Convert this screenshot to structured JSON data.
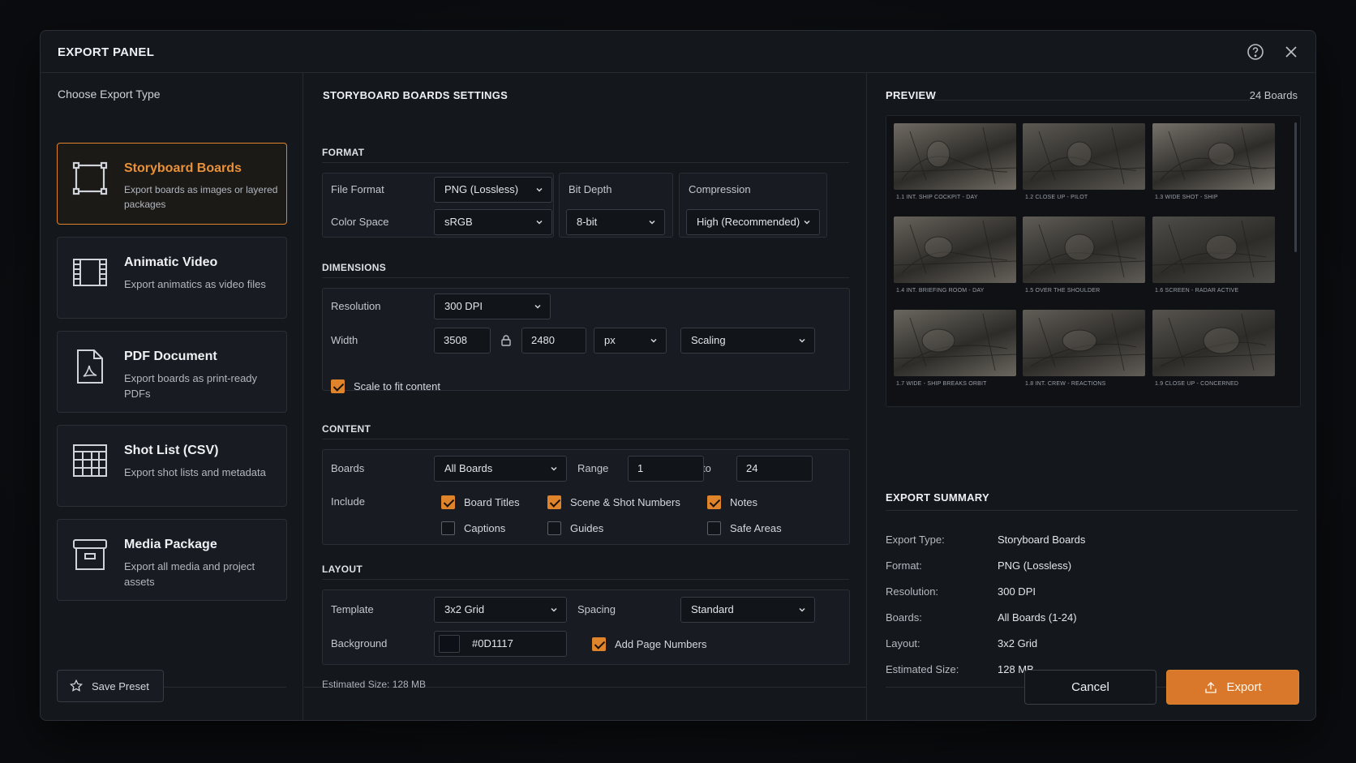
{
  "dialog": {
    "title": "EXPORT PANEL"
  },
  "left": {
    "heading": "Choose Export Type",
    "types": [
      {
        "title": "Storyboard Boards",
        "desc": "Export boards as images or layered packages",
        "icon": "storyboard-frame-icon",
        "active": true
      },
      {
        "title": "Animatic Video",
        "desc": "Export animatics as video files",
        "icon": "film-strip-icon",
        "active": false
      },
      {
        "title": "PDF Document",
        "desc": "Export boards as print-ready PDFs",
        "icon": "pdf-file-icon",
        "active": false
      },
      {
        "title": "Shot List (CSV)",
        "desc": "Export shot lists and metadata",
        "icon": "table-grid-icon",
        "active": false
      },
      {
        "title": "Media Package",
        "desc": "Export all media and project assets",
        "icon": "archive-box-icon",
        "active": false
      }
    ],
    "save_preset": "Save Preset"
  },
  "settings": {
    "heading": "STORYBOARD BOARDS SETTINGS",
    "format": {
      "label": "FORMAT",
      "file_format_label": "File Format",
      "file_format": "PNG (Lossless)",
      "color_space_label": "Color Space",
      "color_space": "sRGB",
      "bit_depth_label": "Bit Depth",
      "bit_depth": "8-bit",
      "compression_label": "Compression",
      "compression": "High (Recommended)"
    },
    "dimensions": {
      "label": "DIMENSIONS",
      "resolution_label": "Resolution",
      "resolution": "300 DPI",
      "width_label": "Width",
      "width": "3508",
      "height": "2480",
      "unit": "px",
      "scaling": "Scaling",
      "scale_to_fit_label": "Scale to fit content",
      "scale_to_fit": true
    },
    "content": {
      "label": "CONTENT",
      "boards_label": "Boards",
      "boards": "All Boards",
      "range_label": "Range",
      "range_from": "1",
      "range_to_label": "to",
      "range_to": "24",
      "include_label": "Include",
      "options": {
        "board_titles": {
          "label": "Board Titles",
          "checked": true
        },
        "scene_shot_numbers": {
          "label": "Scene & Shot Numbers",
          "checked": true
        },
        "notes": {
          "label": "Notes",
          "checked": true
        },
        "captions": {
          "label": "Captions",
          "checked": false
        },
        "guides": {
          "label": "Guides",
          "checked": false
        },
        "safe_areas": {
          "label": "Safe Areas",
          "checked": false
        }
      }
    },
    "layout": {
      "label": "LAYOUT",
      "template_label": "Template",
      "template": "3x2 Grid",
      "spacing_label": "Spacing",
      "spacing": "Standard",
      "background_label": "Background",
      "background": "#0D1117",
      "add_page_numbers_label": "Add Page Numbers",
      "add_page_numbers": true
    },
    "estimated_size": "Estimated Size: 128 MB"
  },
  "preview": {
    "heading": "PREVIEW",
    "count": "24 Boards",
    "boards": [
      {
        "caption": "1.1   INT. SHIP COCKPIT - DAY"
      },
      {
        "caption": "1.2   CLOSE UP - PILOT"
      },
      {
        "caption": "1.3   WIDE SHOT - SHIP"
      },
      {
        "caption": "1.4   INT. BRIEFING ROOM - DAY"
      },
      {
        "caption": "1.5   OVER THE SHOULDER"
      },
      {
        "caption": "1.6   SCREEN - RADAR ACTIVE"
      },
      {
        "caption": "1.7   WIDE - SHIP BREAKS ORBIT"
      },
      {
        "caption": "1.8   INT. CREW - REACTIONS"
      },
      {
        "caption": "1.9   CLOSE UP - CONCERNED"
      }
    ]
  },
  "summary": {
    "heading": "EXPORT SUMMARY",
    "rows": [
      {
        "key": "Export Type:",
        "value": "Storyboard Boards"
      },
      {
        "key": "Format:",
        "value": "PNG (Lossless)"
      },
      {
        "key": "Resolution:",
        "value": "300 DPI"
      },
      {
        "key": "Boards:",
        "value": "All Boards (1-24)"
      },
      {
        "key": "Layout:",
        "value": "3x2 Grid"
      },
      {
        "key": "Estimated Size:",
        "value": "128 MB"
      }
    ]
  },
  "actions": {
    "cancel": "Cancel",
    "export": "Export"
  },
  "colors": {
    "accent": "#E0842B",
    "panel": "#14171C",
    "background_swatch": "#0D1117"
  }
}
